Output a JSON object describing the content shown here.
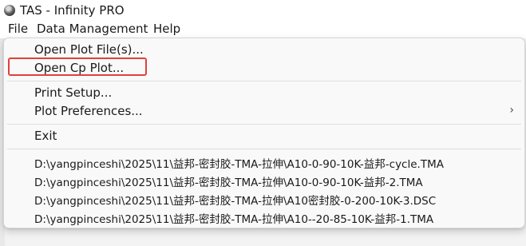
{
  "window": {
    "title": "TAS - Infinity PRO"
  },
  "menubar": {
    "items": [
      "File",
      "Data Management",
      "Help"
    ]
  },
  "file_menu": {
    "open_plot_files": "Open Plot File(s)...",
    "open_cp_plot": "Open Cp Plot...",
    "print_setup": "Print Setup...",
    "plot_preferences": "Plot Preferences...",
    "submenu_arrow": "›",
    "exit": "Exit",
    "recent_files": [
      "D:\\yangpinceshi\\2025\\11\\益邦-密封胶-TMA-拉伸\\A10-0-90-10K-益邦-cycle.TMA",
      "D:\\yangpinceshi\\2025\\11\\益邦-密封胶-TMA-拉伸\\A10-0-90-10K-益邦-2.TMA",
      "D:\\yangpinceshi\\2025\\11\\益邦-密封胶-TMA-拉伸\\A10密封胶-0-200-10K-3.DSC",
      "D:\\yangpinceshi\\2025\\11\\益邦-密封胶-TMA-拉伸\\A10--20-85-10K-益邦-1.TMA"
    ]
  },
  "colors": {
    "highlight_border": "#e0413a",
    "menu_background": "#f9f9f9"
  },
  "icons": {
    "app": "infinity-pro-app-icon",
    "submenu": "chevron-right-icon"
  }
}
